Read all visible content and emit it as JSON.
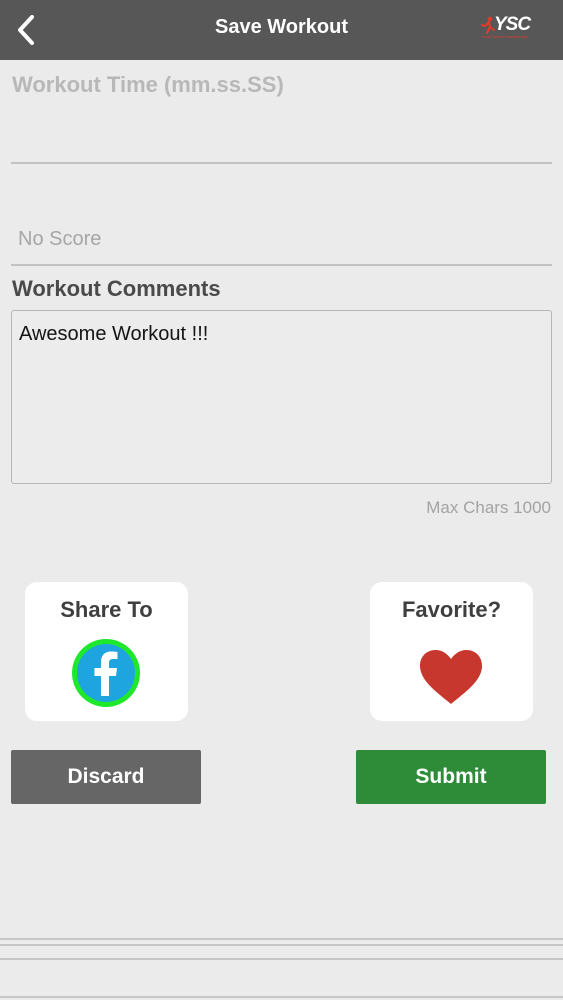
{
  "header": {
    "title": "Save Workout",
    "brand": "YSC",
    "brand_tagline": "Youth Sports Conditioning",
    "back_icon": "chevron-left-icon",
    "background_color": "#575757"
  },
  "form": {
    "time_label": "Workout Time (mm.ss.SS)",
    "time_value": "",
    "score_value": "",
    "score_placeholder": "No Score",
    "comments_label": "Workout Comments",
    "comments_value": "Awesome Workout !!!",
    "max_chars_text": "Max Chars 1000"
  },
  "share": {
    "label": "Share To",
    "icon": "facebook-icon",
    "icon_color": "#1ea5df",
    "ring_color": "#1ee82c"
  },
  "favorite": {
    "label": "Favorite?",
    "icon": "heart-icon",
    "icon_color": "#c8372d"
  },
  "actions": {
    "discard_label": "Discard",
    "discard_color": "#666666",
    "submit_label": "Submit",
    "submit_color": "#2e8b37"
  }
}
